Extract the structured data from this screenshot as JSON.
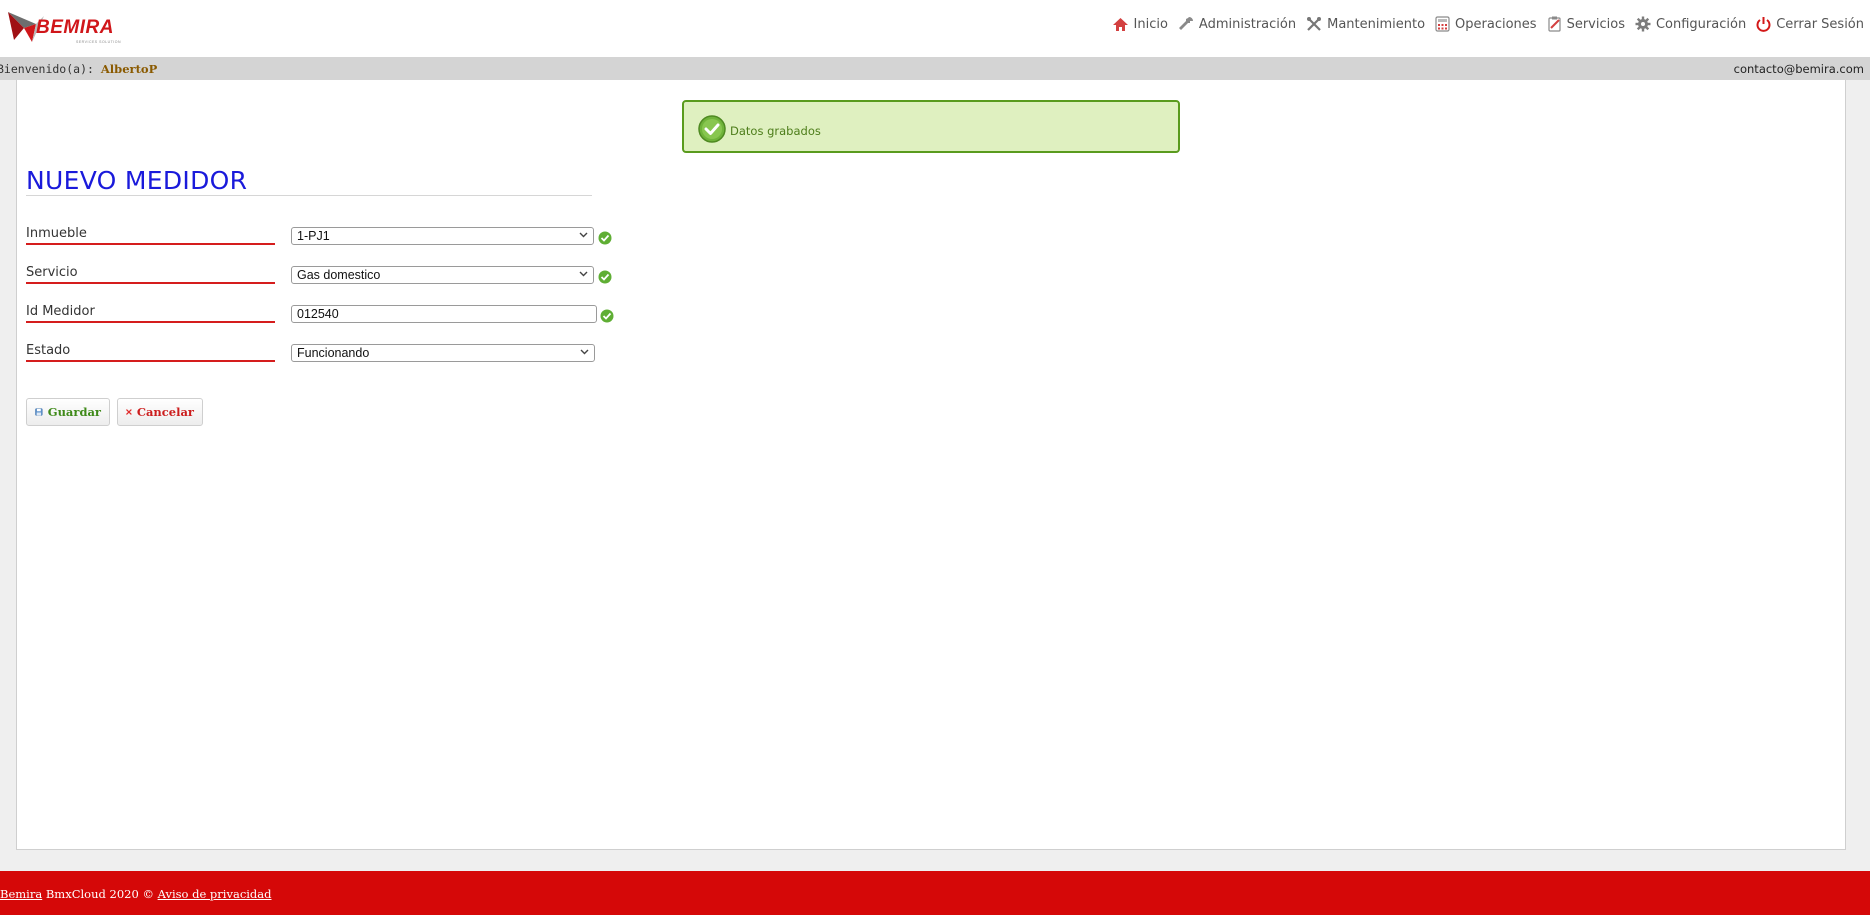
{
  "header": {
    "logo_text": "BEMIRA",
    "logo_subtext": "SERVICES SOLUTION",
    "nav": [
      {
        "label": "Inicio",
        "icon": "home-icon"
      },
      {
        "label": "Administración",
        "icon": "wrench-icon"
      },
      {
        "label": "Mantenimiento",
        "icon": "tools-icon"
      },
      {
        "label": "Operaciones",
        "icon": "calculator-icon"
      },
      {
        "label": "Servicios",
        "icon": "clipboard-icon"
      },
      {
        "label": "Configuración",
        "icon": "gear-icon"
      },
      {
        "label": "Cerrar Sesión",
        "icon": "power-icon"
      }
    ]
  },
  "welcome": {
    "prefix": "Bienvenido(a):",
    "user": "AlbertoP",
    "contact": "contacto@bemira.com"
  },
  "alert": {
    "text": "Datos grabados"
  },
  "form": {
    "title": "NUEVO MEDIDOR",
    "fields": [
      {
        "label": "Inmueble",
        "value": "1-PJ1",
        "type": "select"
      },
      {
        "label": "Servicio",
        "value": "Gas domestico",
        "type": "select"
      },
      {
        "label": "Id Medidor",
        "value": "012540",
        "type": "input"
      },
      {
        "label": "Estado",
        "value": "Funcionando",
        "type": "select"
      }
    ],
    "save_label": "Guardar",
    "cancel_label": "Cancelar"
  },
  "footer": {
    "brand_link": "Bemira",
    "text": " BmxCloud 2020 © ",
    "privacy_link": "Aviso de privacidad"
  },
  "colors": {
    "brand_red": "#d50808",
    "title_blue": "#1a1adb",
    "success_green": "#5a9b1e"
  }
}
